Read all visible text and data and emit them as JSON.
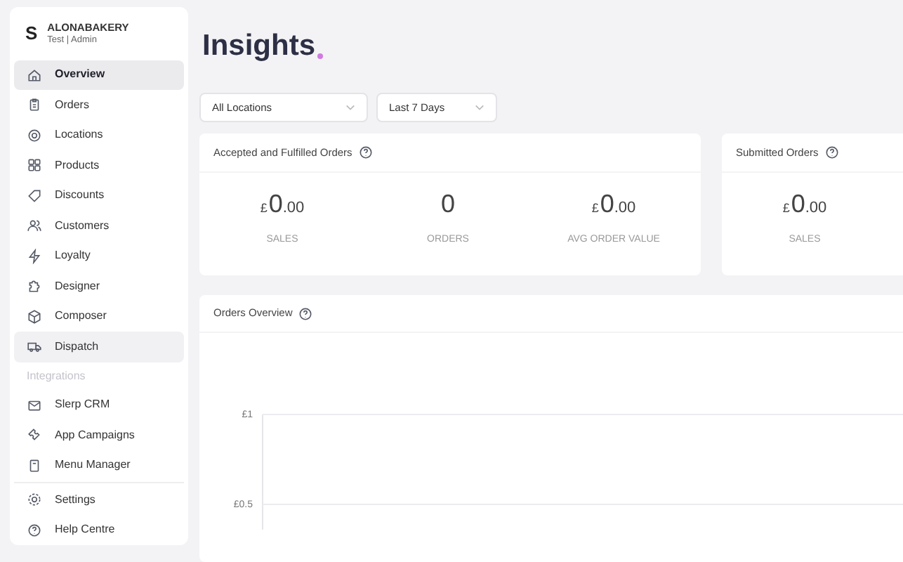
{
  "account": {
    "logo": "S",
    "name": "ALONABAKERY",
    "user_line": "Test | Admin"
  },
  "nav": [
    {
      "label": "Overview",
      "selected": true,
      "hovered": false
    },
    {
      "label": "Orders",
      "selected": false,
      "hovered": false
    },
    {
      "label": "Locations",
      "selected": false,
      "hovered": false
    },
    {
      "label": "Products",
      "selected": false,
      "hovered": false
    },
    {
      "label": "Discounts",
      "selected": false,
      "hovered": false
    },
    {
      "label": "Customers",
      "selected": false,
      "hovered": false
    },
    {
      "label": "Loyalty",
      "selected": false,
      "hovered": false
    },
    {
      "label": "Designer",
      "selected": false,
      "hovered": false
    },
    {
      "label": "Composer",
      "selected": false,
      "hovered": false
    },
    {
      "label": "Dispatch",
      "selected": false,
      "hovered": true
    }
  ],
  "integrations_heading": "Integrations",
  "integrations": [
    {
      "label": "Slerp CRM"
    },
    {
      "label": "App Campaigns"
    },
    {
      "label": "Menu Manager"
    }
  ],
  "footer_nav": [
    {
      "label": "Settings"
    },
    {
      "label": "Help Centre"
    }
  ],
  "page_title": "Insights",
  "filters": [
    {
      "value": "All Locations"
    },
    {
      "value": "Last 7 Days"
    }
  ],
  "cards": [
    {
      "title": "Accepted and Fulfilled Orders",
      "stats": [
        {
          "currency": "£",
          "whole": "0",
          "decimals": ".00",
          "label": "SALES"
        },
        {
          "whole": "0",
          "label": "ORDERS"
        },
        {
          "currency": "£",
          "whole": "0",
          "decimals": ".00",
          "label": "AVG ORDER VALUE"
        }
      ]
    },
    {
      "title": "Submitted Orders",
      "stats": [
        {
          "currency": "£",
          "whole": "0",
          "decimals": ".00",
          "label": "SALES"
        }
      ]
    }
  ],
  "chart_panel": {
    "title": "Orders Overview",
    "y_axis_labels": [
      "£1",
      "£0.5"
    ]
  }
}
